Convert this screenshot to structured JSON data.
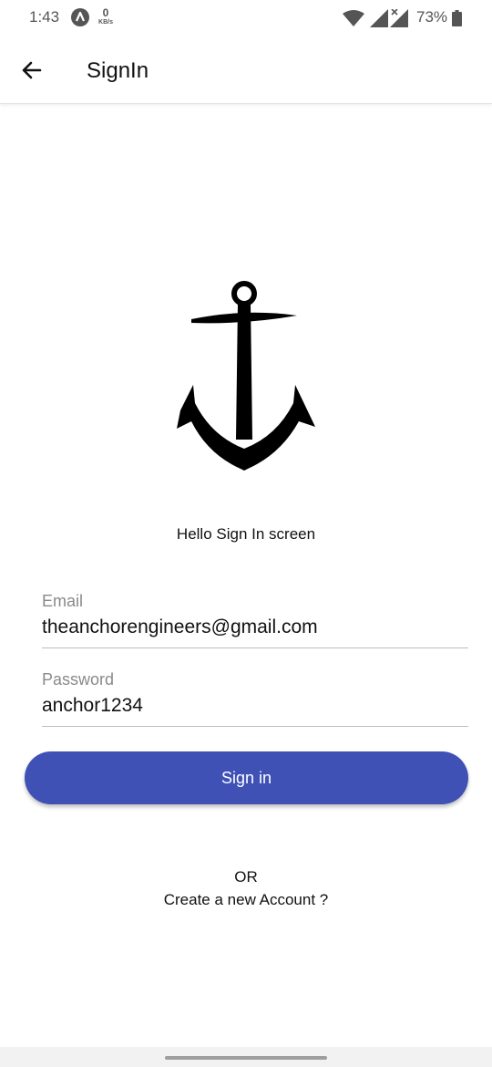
{
  "status_bar": {
    "time": "1:43",
    "speed_value": "0",
    "speed_unit": "KB/s",
    "battery_percent": "73%",
    "icons": [
      "app-notification-icon",
      "wifi-icon",
      "cell-signal-icon",
      "cell-signal-no-data-icon",
      "battery-icon"
    ]
  },
  "app_bar": {
    "back_icon": "arrow-left-icon",
    "title": "SignIn"
  },
  "logo": {
    "icon": "anchor-icon"
  },
  "hello_text": "Hello  Sign In screen",
  "form": {
    "email": {
      "label": "Email",
      "value": "theanchorengineers@gmail.com"
    },
    "password": {
      "label": "Password",
      "value": "anchor1234"
    }
  },
  "signin_button": {
    "label": "Sign in",
    "color": "#3f51b5"
  },
  "or_text": "OR",
  "create_account_text": "Create a new Account ?"
}
